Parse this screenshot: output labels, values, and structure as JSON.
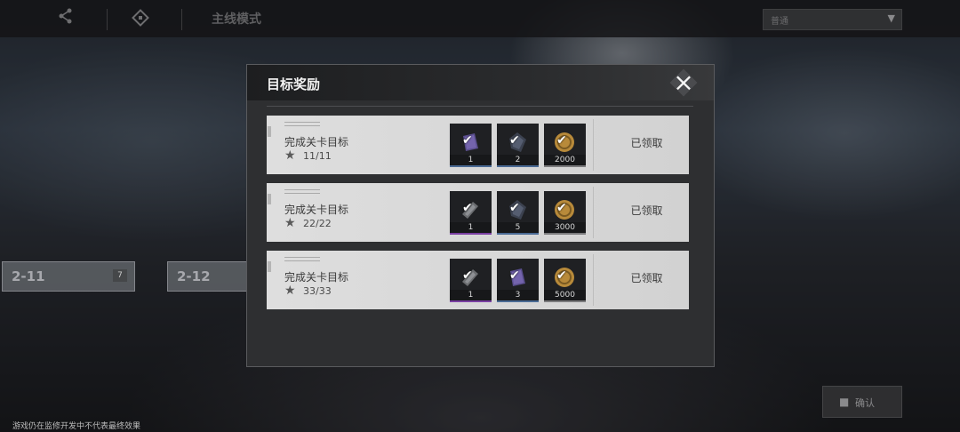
{
  "topbar": {
    "mode_label": "主线模式",
    "dropdown_value": "普通"
  },
  "background": {
    "level_cards": [
      {
        "label": "2-11",
        "badge": "7"
      },
      {
        "label": "2-12"
      }
    ],
    "disclaimer": "游戏仍在监修开发中不代表最终效果",
    "confirm_label": "确认"
  },
  "modal": {
    "title": "目标奖励",
    "rows": [
      {
        "objective": "完成关卡目标",
        "progress": "11/11",
        "status": "已领取",
        "rewards": [
          {
            "icon": "purple-book-icon",
            "quality": "blue",
            "qty": "1"
          },
          {
            "icon": "dark-crystal-icon",
            "quality": "blue",
            "qty": "2"
          },
          {
            "icon": "gold-coin-icon",
            "quality": "grey",
            "qty": "2000"
          }
        ]
      },
      {
        "objective": "完成关卡目标",
        "progress": "22/22",
        "status": "已领取",
        "rewards": [
          {
            "icon": "grey-scroll-icon",
            "quality": "purple",
            "qty": "1"
          },
          {
            "icon": "dark-crystal-icon",
            "quality": "blue",
            "qty": "5"
          },
          {
            "icon": "gold-coin-icon",
            "quality": "grey",
            "qty": "3000"
          }
        ]
      },
      {
        "objective": "完成关卡目标",
        "progress": "33/33",
        "status": "已领取",
        "rewards": [
          {
            "icon": "grey-scroll-icon",
            "quality": "purple",
            "qty": "1"
          },
          {
            "icon": "purple-book-icon",
            "quality": "blue",
            "qty": "3"
          },
          {
            "icon": "gold-coin-icon",
            "quality": "grey",
            "qty": "5000"
          }
        ]
      }
    ]
  },
  "colors": {
    "quality_blue": "#4a6a94",
    "quality_purple": "#7a3fa2",
    "quality_grey": "#7b7b7d"
  }
}
